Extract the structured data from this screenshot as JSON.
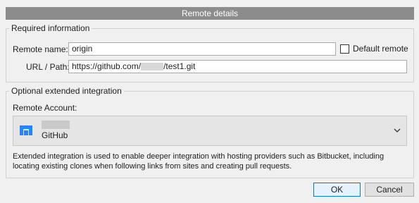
{
  "dialog": {
    "title": "Remote details"
  },
  "required": {
    "legend": "Required information",
    "remote_name_label": "Remote name:",
    "remote_name_value": "origin",
    "default_remote_label": "Default remote",
    "default_remote_checked": false,
    "url_label": "URL / Path:",
    "url_prefix": "https://github.com/",
    "url_suffix": "/test1.git"
  },
  "optional": {
    "legend": "Optional extended integration",
    "account_label": "Remote Account:",
    "account_service": "GitHub",
    "account_icon": "github-logo-icon",
    "note": "Extended integration is used to enable deeper integration with hosting providers such as Bitbucket, including locating existing clones when following links from sites and creating pull requests."
  },
  "buttons": {
    "ok": "OK",
    "cancel": "Cancel"
  },
  "colors": {
    "title_bar": "#8c8c8c",
    "accent": "#0078d7",
    "logo": "#2684ff"
  }
}
